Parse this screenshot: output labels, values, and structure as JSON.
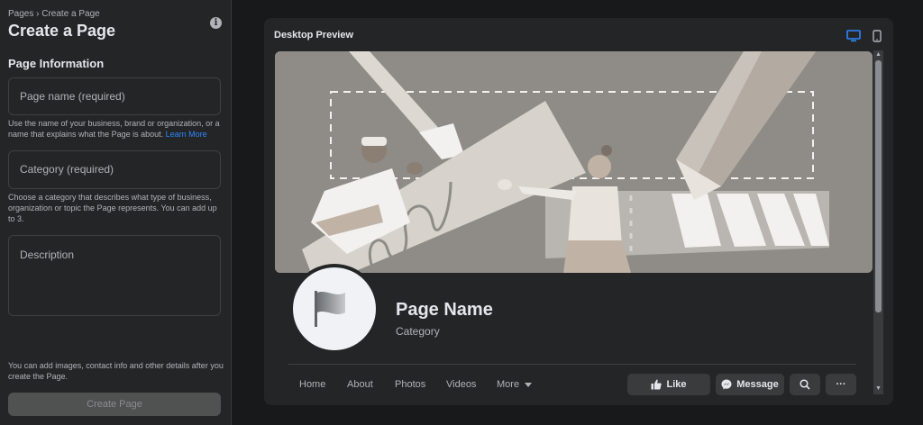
{
  "sidebar": {
    "breadcrumb": "Pages › Create a Page",
    "title": "Create a Page",
    "info_glyph": "i",
    "section_title": "Page Information",
    "name_placeholder": "Page name (required)",
    "name_helper": "Use the name of your business, brand or organization, or a name that explains what the Page is about.",
    "learn_more": "Learn More",
    "category_placeholder": "Category (required)",
    "category_helper": "Choose a category that describes what type of business, organization or topic the Page represents. You can add up to 3.",
    "description_placeholder": "Description",
    "footer_note": "You can add images, contact info and other details after you create the Page.",
    "create_button": "Create Page"
  },
  "preview": {
    "title": "Desktop Preview",
    "desktop_icon": "desktop-icon",
    "mobile_icon": "mobile-icon",
    "page_name": "Page Name",
    "category": "Category",
    "tabs": [
      "Home",
      "About",
      "Photos",
      "Videos",
      "More"
    ],
    "like_label": "Like",
    "message_label": "Message",
    "more_glyph": "···"
  },
  "colors": {
    "accent": "#2d88ff",
    "panel": "#242526",
    "background": "#18191a"
  }
}
